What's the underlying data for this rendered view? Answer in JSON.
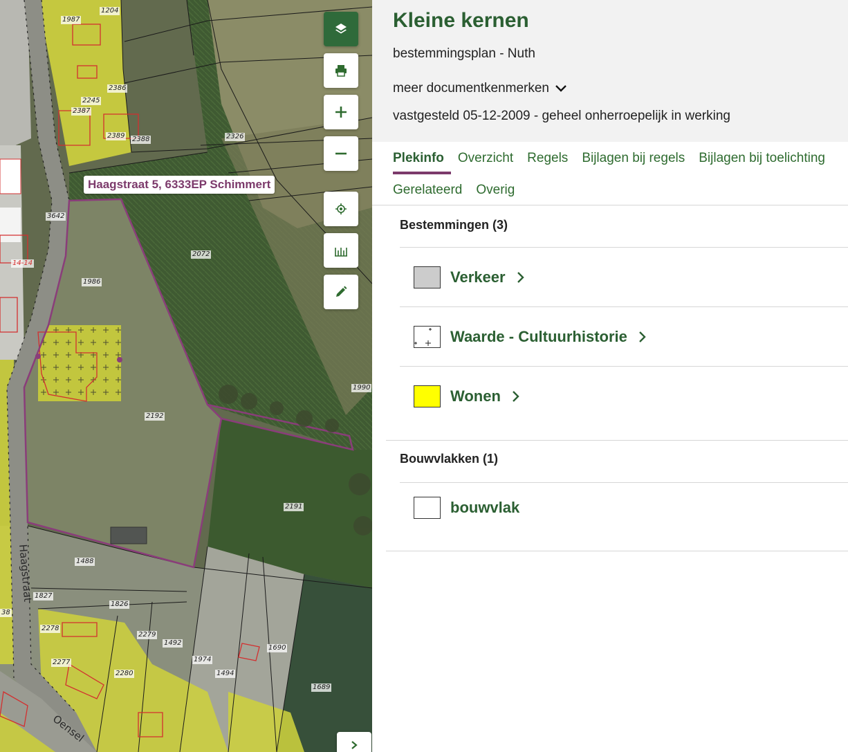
{
  "map": {
    "address_callout": "Haagstraat 5, 6333EP Schimmert",
    "street_labels": [
      "Haagstraat",
      "Oensel"
    ],
    "parcel_labels": [
      "1204",
      "1987",
      "2386",
      "2245",
      "2387",
      "2389",
      "2388",
      "2326",
      "3642",
      "2072",
      "1986",
      "1990",
      "2192",
      "2191",
      "1488",
      "1827",
      "1826",
      "2278",
      "2279",
      "1492",
      "1690",
      "1974",
      "2277",
      "2280",
      "1494",
      "1689",
      "14-14",
      "38"
    ],
    "buttons": {
      "layers": "layers-icon",
      "print": "print-icon",
      "zoom_in": "plus-icon",
      "zoom_out": "minus-icon",
      "locate": "crosshair-icon",
      "measure": "ruler-icon",
      "draw": "pencil-icon",
      "panel_toggle": "chevron-right-icon"
    }
  },
  "document": {
    "title": "Kleine kernen",
    "subtitle": "bestemmingsplan - Nuth",
    "meta_toggle": "meer documentkenmerken",
    "status": "vastgesteld 05-12-2009 - geheel onherroepelijk in werking"
  },
  "tabs": {
    "row1": [
      "Plekinfo",
      "Overzicht",
      "Regels",
      "Bijlagen bij regels",
      "Bijlagen bij toelichting"
    ],
    "row2": [
      "Gerelateerd",
      "Overig"
    ],
    "active": "Plekinfo"
  },
  "bestemmingen": {
    "title": "Bestemmingen (3)",
    "items": [
      {
        "label": "Verkeer",
        "color": "#cccccc"
      },
      {
        "label": "Waarde - Cultuurhistorie",
        "color": "#ffffff"
      },
      {
        "label": "Wonen",
        "color": "#ffff00"
      }
    ]
  },
  "bouwvlakken": {
    "title": "Bouwvlakken (1)",
    "items": [
      {
        "label": "bouwvlak",
        "color": "#ffffff"
      }
    ]
  }
}
